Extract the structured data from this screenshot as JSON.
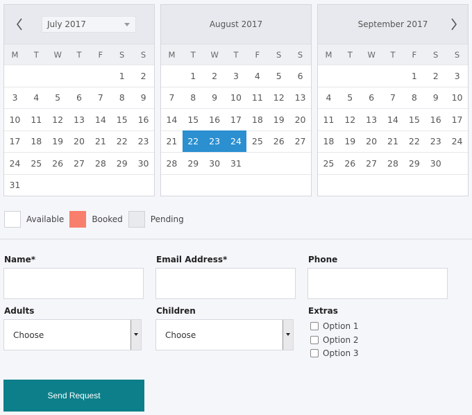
{
  "weekdays": [
    "M",
    "T",
    "W",
    "T",
    "F",
    "S",
    "S"
  ],
  "calendars": [
    {
      "title": "July 2017",
      "weeks": [
        [
          "",
          "",
          "",
          "",
          "",
          "1",
          "2"
        ],
        [
          "3",
          "4",
          "5",
          "6",
          "7",
          "8",
          "9"
        ],
        [
          "10",
          "11",
          "12",
          "13",
          "14",
          "15",
          "16"
        ],
        [
          "17",
          "18",
          "19",
          "20",
          "21",
          "22",
          "23"
        ],
        [
          "24",
          "25",
          "26",
          "27",
          "28",
          "29",
          "30"
        ],
        [
          "31",
          "",
          "",
          "",
          "",
          "",
          ""
        ]
      ]
    },
    {
      "title": "August 2017",
      "weeks": [
        [
          "",
          "1",
          "2",
          "3",
          "4",
          "5",
          "6"
        ],
        [
          "7",
          "8",
          "9",
          "10",
          "11",
          "12",
          "13"
        ],
        [
          "14",
          "15",
          "16",
          "17",
          "18",
          "19",
          "20"
        ],
        [
          "21",
          "22",
          "23",
          "24",
          "25",
          "26",
          "27"
        ],
        [
          "28",
          "29",
          "30",
          "31",
          "",
          "",
          ""
        ],
        [
          "",
          "",
          "",
          "",
          "",
          "",
          ""
        ]
      ],
      "selected": [
        "22",
        "23",
        "24"
      ]
    },
    {
      "title": "September 2017",
      "weeks": [
        [
          "",
          "",
          "",
          "",
          "1",
          "2",
          "3"
        ],
        [
          "4",
          "5",
          "6",
          "7",
          "8",
          "9",
          "10"
        ],
        [
          "11",
          "12",
          "13",
          "14",
          "15",
          "16",
          "17"
        ],
        [
          "18",
          "19",
          "20",
          "21",
          "22",
          "23",
          "24"
        ],
        [
          "25",
          "26",
          "27",
          "28",
          "29",
          "30",
          ""
        ],
        [
          "",
          "",
          "",
          "",
          "",
          "",
          ""
        ]
      ]
    }
  ],
  "legend": {
    "available": "Available",
    "booked": "Booked",
    "pending": "Pending",
    "colors": {
      "available": "#ffffff",
      "booked": "#f87f6b",
      "pending": "#e9eaee"
    }
  },
  "form": {
    "name_label": "Name*",
    "email_label": "Email Address*",
    "phone_label": "Phone",
    "adults_label": "Adults",
    "children_label": "Children",
    "extras_label": "Extras",
    "adults_value": "Choose",
    "children_value": "Choose",
    "extras": [
      "Option 1",
      "Option 2",
      "Option 3"
    ],
    "submit": "Send Request"
  },
  "colors": {
    "selected": "#2b8fd0",
    "button": "#0c7f8a"
  }
}
